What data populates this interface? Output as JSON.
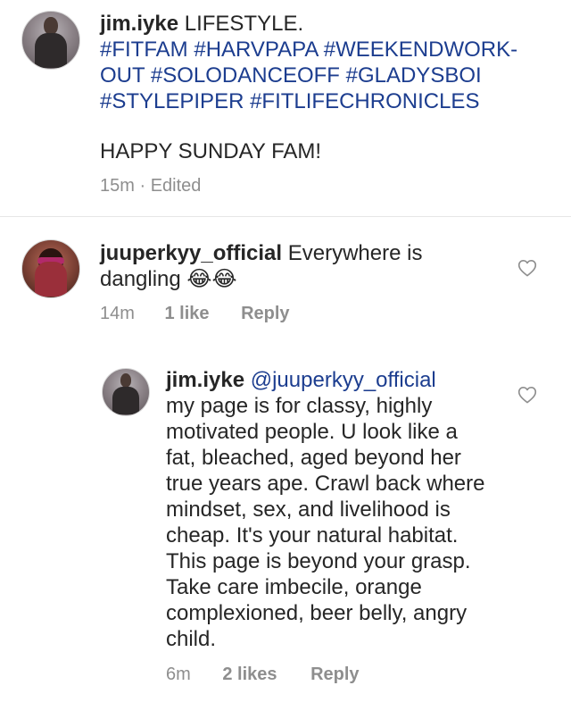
{
  "caption": {
    "username": "jim.iyke",
    "text_intro": "LIFESTYLE.",
    "hashtag_lines": [
      "#FITFAM #HARVPAPA #WEEKENDWORK-",
      "OUT #SOLODANCEOFF #GLADYSBOI",
      "#STYLEPIPER #FITLIFECHRONICLES"
    ],
    "message": "HAPPY SUNDAY FAM!",
    "time": "15m",
    "separator": "·",
    "edited": "Edited"
  },
  "comment": {
    "username": "juuperkyy_official",
    "text_line1": "Everywhere is",
    "text_line2": "dangling 😂😂",
    "time": "14m",
    "likes": "1 like",
    "reply": "Reply",
    "like_icon": "heart-outline"
  },
  "reply": {
    "username": "jim.iyke",
    "mention": "@juuperkyy_official",
    "lines": [
      "my page is for classy, highly",
      "motivated people. U look like a",
      "fat, bleached, aged beyond her",
      "true years ape. Crawl back where",
      "mindset, sex, and livelihood is",
      "cheap. It's your natural habitat.",
      "This page is beyond your grasp.",
      "Take care imbecile, orange",
      "complexioned,  beer belly, angry",
      "child."
    ],
    "time": "6m",
    "likes": "2 likes",
    "reply": "Reply",
    "like_icon": "heart-outline"
  }
}
